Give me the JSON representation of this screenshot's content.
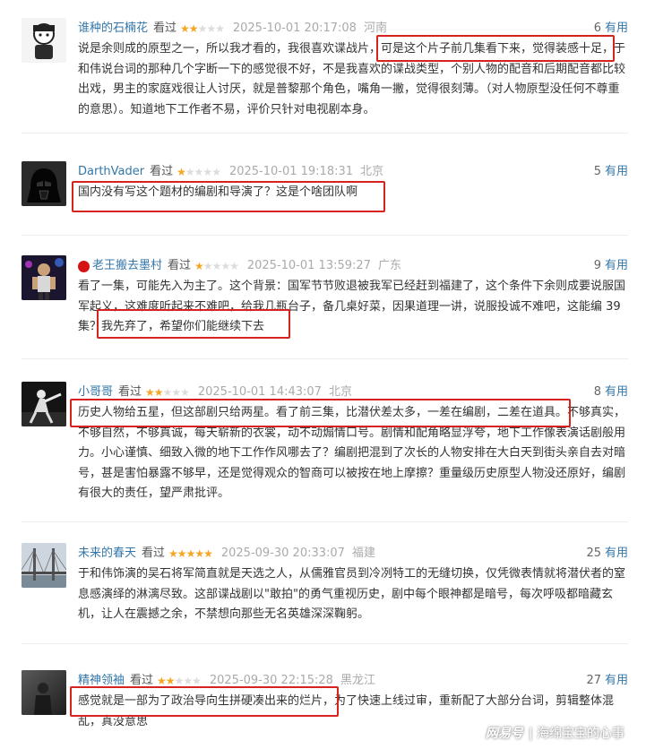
{
  "useful_label": "有用",
  "reviews": [
    {
      "user": "谁种的石楠花",
      "rating_label": "看过",
      "stars": 2,
      "time": "2025-10-01 20:17:08",
      "location": "河南",
      "votes": "6",
      "content": "说是余则成的原型之一，所以我才看的，我很喜欢谍战片，可是这个片子前几集看下来，觉得装感十足，于和伟说台词的那种几个字断一下的感觉很不好，不是我喜欢的谍战类型，个别人物的配音和后期配音都比较出戏，男主的家庭戏很让人讨厌，就是普黎那个角色，嘴角一撇，觉得很刻薄。（对人物原型没任何不尊重的意思）。知道地下工作者不易，评价只针对电视剧本身。"
    },
    {
      "user": "DarthVader",
      "rating_label": "看过",
      "stars": 1,
      "time": "2025-10-01 19:18:31",
      "location": "北京",
      "votes": "5",
      "content": "国内没有写这个题材的编剧和导演了？这是个啥团队啊"
    },
    {
      "user": "老王搬去墨村",
      "rating_label": "看过",
      "stars": 1,
      "time": "2025-10-01 13:59:27",
      "location": "广东",
      "votes": "9",
      "content": "看了一集，可能先入为主了。这个背景：国军节节败退被我军已经赶到福建了，这个条件下余则成要说服国军起义，这难度听起来不难吧，给我几瓶台子，备几桌好菜，因果道理一讲，说服投诚不难吧，这能编 39集？我先弃了，希望你们能继续下去"
    },
    {
      "user": "小哥哥",
      "rating_label": "看过",
      "stars": 2,
      "time": "2025-10-01 14:43:07",
      "location": "北京",
      "votes": "8",
      "content": "历史人物给五星，但这部剧只给两星。看了前三集，比潜伏差太多，一差在编剧，二差在道具。不够真实，不够自然，不够真诚，每天崭新的衣裳，动不动煽情口号。剧情和配角略显浮夸，地下工作像表演话剧般用力。小心谨慎、细致入微的地下工作作风哪去了？编剧把混到了次长的人物安排在大白天到街头亲自去对暗号，甚是害怕暴露不够早，还是觉得观众的智商可以被按在地上摩擦？重量级历史原型人物没还原好，编剧有很大的责任，望严肃批评。"
    },
    {
      "user": "未来的春天",
      "rating_label": "看过",
      "stars": 5,
      "time": "2025-09-30 20:33:07",
      "location": "福建",
      "votes": "25",
      "content": "于和伟饰演的吴石将军简直就是天选之人，从儒雅官员到冷冽特工的无缝切换，仅凭微表情就将潜伏者的窒息感演绎的淋漓尽致。这部谍战剧以\"敢拍\"的勇气重视历史，剧中每个眼神都是暗号，每次呼吸都暗藏玄机，让人在震撼之余，不禁想向那些无名英雄深深鞠躬。"
    },
    {
      "user": "精神领袖",
      "rating_label": "看过",
      "stars": 2,
      "time": "2025-09-30 22:15:28",
      "location": "黑龙江",
      "votes": "27",
      "content": "感觉就是一部为了政治导向生拼硬凑出来的烂片，为了快速上线过审，重新配了大部分台词，剪辑整体混乱，真没意思"
    }
  ],
  "watermark": {
    "brand": "网易号",
    "separator": "|",
    "author": "海绵宝宝的心事"
  },
  "colors": {
    "username": "#3377aa",
    "star_on": "#f5a623",
    "star_off": "#dcdcdc",
    "highlight_box": "#d6231e"
  }
}
